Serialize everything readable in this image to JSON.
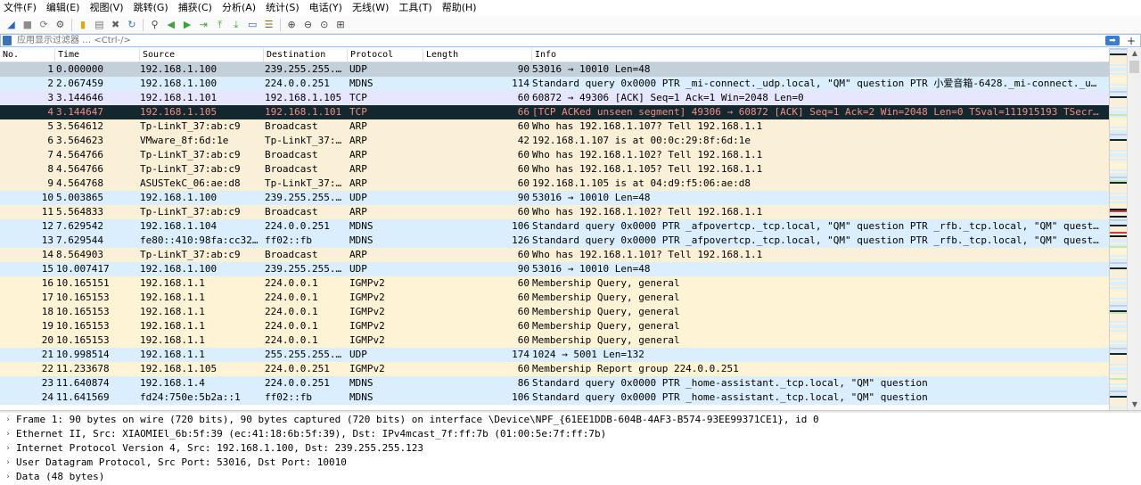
{
  "menu": [
    "文件(F)",
    "编辑(E)",
    "视图(V)",
    "跳转(G)",
    "捕获(C)",
    "分析(A)",
    "统计(S)",
    "电话(Y)",
    "无线(W)",
    "工具(T)",
    "帮助(H)"
  ],
  "toolbar_icons": [
    "shark-fin-start-icon",
    "stop-icon",
    "restart-icon",
    "capture-options-icon",
    "sep",
    "open-file-icon",
    "save-file-icon",
    "close-file-icon",
    "reload-icon",
    "sep",
    "find-icon",
    "go-back-icon",
    "go-forward-icon",
    "go-to-packet-icon",
    "first-packet-icon",
    "last-packet-icon",
    "auto-scroll-icon",
    "colorize-icon",
    "sep",
    "zoom-in-icon",
    "zoom-out-icon",
    "normal-size-icon",
    "resize-columns-icon"
  ],
  "filter": {
    "placeholder": "应用显示过滤器 … <Ctrl-/>",
    "plus": "+"
  },
  "columns": {
    "no": "No.",
    "time": "Time",
    "source": "Source",
    "destination": "Destination",
    "protocol": "Protocol",
    "length": "Length",
    "info": "Info"
  },
  "packets": [
    {
      "no": "1",
      "time": "0.000000",
      "src": "192.168.1.100",
      "dst": "239.255.255.…",
      "proto": "UDP",
      "len": "90",
      "info": "53016 → 10010 Len=48",
      "style": "first"
    },
    {
      "no": "2",
      "time": "2.067459",
      "src": "192.168.1.100",
      "dst": "224.0.0.251",
      "proto": "MDNS",
      "len": "114",
      "info": "Standard query 0x0000 PTR _mi-connect._udp.local, \"QM\" question PTR 小爱音箱-6428._mi-connect._u…",
      "style": "udp"
    },
    {
      "no": "3",
      "time": "3.144646",
      "src": "192.168.1.101",
      "dst": "192.168.1.105",
      "proto": "TCP",
      "len": "60",
      "info": "60872 → 49306 [ACK] Seq=1 Ack=1 Win=2048 Len=0",
      "style": "tcp"
    },
    {
      "no": "4",
      "time": "3.144647",
      "src": "192.168.1.105",
      "dst": "192.168.1.101",
      "proto": "TCP",
      "len": "66",
      "info": "[TCP ACKed unseen segment] 49306 → 60872 [ACK] Seq=1 Ack=2 Win=2048 Len=0 TSval=111915193 TSecr…",
      "style": "sel"
    },
    {
      "no": "5",
      "time": "3.564612",
      "src": "Tp-LinkT_37:ab:c9",
      "dst": "Broadcast",
      "proto": "ARP",
      "len": "60",
      "info": "Who has 192.168.1.107? Tell 192.168.1.1",
      "style": "arp"
    },
    {
      "no": "6",
      "time": "3.564623",
      "src": "VMware_8f:6d:1e",
      "dst": "Tp-LinkT_37:…",
      "proto": "ARP",
      "len": "42",
      "info": "192.168.1.107 is at 00:0c:29:8f:6d:1e",
      "style": "arp"
    },
    {
      "no": "7",
      "time": "4.564766",
      "src": "Tp-LinkT_37:ab:c9",
      "dst": "Broadcast",
      "proto": "ARP",
      "len": "60",
      "info": "Who has 192.168.1.102? Tell 192.168.1.1",
      "style": "arp"
    },
    {
      "no": "8",
      "time": "4.564766",
      "src": "Tp-LinkT_37:ab:c9",
      "dst": "Broadcast",
      "proto": "ARP",
      "len": "60",
      "info": "Who has 192.168.1.105? Tell 192.168.1.1",
      "style": "arp"
    },
    {
      "no": "9",
      "time": "4.564768",
      "src": "ASUSTekC_06:ae:d8",
      "dst": "Tp-LinkT_37:…",
      "proto": "ARP",
      "len": "60",
      "info": "192.168.1.105 is at 04:d9:f5:06:ae:d8",
      "style": "arp"
    },
    {
      "no": "10",
      "time": "5.003865",
      "src": "192.168.1.100",
      "dst": "239.255.255.…",
      "proto": "UDP",
      "len": "90",
      "info": "53016 → 10010 Len=48",
      "style": "udp"
    },
    {
      "no": "11",
      "time": "5.564833",
      "src": "Tp-LinkT_37:ab:c9",
      "dst": "Broadcast",
      "proto": "ARP",
      "len": "60",
      "info": "Who has 192.168.1.102? Tell 192.168.1.1",
      "style": "arp"
    },
    {
      "no": "12",
      "time": "7.629542",
      "src": "192.168.1.104",
      "dst": "224.0.0.251",
      "proto": "MDNS",
      "len": "106",
      "info": "Standard query 0x0000 PTR _afpovertcp._tcp.local, \"QM\" question PTR _rfb._tcp.local, \"QM\" quest…",
      "style": "udp"
    },
    {
      "no": "13",
      "time": "7.629544",
      "src": "fe80::410:98fa:cc32…",
      "dst": "ff02::fb",
      "proto": "MDNS",
      "len": "126",
      "info": "Standard query 0x0000 PTR _afpovertcp._tcp.local, \"QM\" question PTR _rfb._tcp.local, \"QM\" quest…",
      "style": "udp"
    },
    {
      "no": "14",
      "time": "8.564903",
      "src": "Tp-LinkT_37:ab:c9",
      "dst": "Broadcast",
      "proto": "ARP",
      "len": "60",
      "info": "Who has 192.168.1.101? Tell 192.168.1.1",
      "style": "arp"
    },
    {
      "no": "15",
      "time": "10.007417",
      "src": "192.168.1.100",
      "dst": "239.255.255.…",
      "proto": "UDP",
      "len": "90",
      "info": "53016 → 10010 Len=48",
      "style": "udp"
    },
    {
      "no": "16",
      "time": "10.165151",
      "src": "192.168.1.1",
      "dst": "224.0.0.1",
      "proto": "IGMPv2",
      "len": "60",
      "info": "Membership Query, general",
      "style": "igmp"
    },
    {
      "no": "17",
      "time": "10.165153",
      "src": "192.168.1.1",
      "dst": "224.0.0.1",
      "proto": "IGMPv2",
      "len": "60",
      "info": "Membership Query, general",
      "style": "igmp"
    },
    {
      "no": "18",
      "time": "10.165153",
      "src": "192.168.1.1",
      "dst": "224.0.0.1",
      "proto": "IGMPv2",
      "len": "60",
      "info": "Membership Query, general",
      "style": "igmp"
    },
    {
      "no": "19",
      "time": "10.165153",
      "src": "192.168.1.1",
      "dst": "224.0.0.1",
      "proto": "IGMPv2",
      "len": "60",
      "info": "Membership Query, general",
      "style": "igmp"
    },
    {
      "no": "20",
      "time": "10.165153",
      "src": "192.168.1.1",
      "dst": "224.0.0.1",
      "proto": "IGMPv2",
      "len": "60",
      "info": "Membership Query, general",
      "style": "igmp"
    },
    {
      "no": "21",
      "time": "10.998514",
      "src": "192.168.1.1",
      "dst": "255.255.255.…",
      "proto": "UDP",
      "len": "174",
      "info": "1024 → 5001 Len=132",
      "style": "udp"
    },
    {
      "no": "22",
      "time": "11.233678",
      "src": "192.168.1.105",
      "dst": "224.0.0.251",
      "proto": "IGMPv2",
      "len": "60",
      "info": "Membership Report group 224.0.0.251",
      "style": "igmp"
    },
    {
      "no": "23",
      "time": "11.640874",
      "src": "192.168.1.4",
      "dst": "224.0.0.251",
      "proto": "MDNS",
      "len": "86",
      "info": "Standard query 0x0000 PTR _home-assistant._tcp.local, \"QM\" question",
      "style": "udp"
    },
    {
      "no": "24",
      "time": "11.641569",
      "src": "fd24:750e:5b2a::1",
      "dst": "ff02::fb",
      "proto": "MDNS",
      "len": "106",
      "info": "Standard query 0x0000 PTR _home-assistant._tcp.local, \"QM\" question",
      "style": "udp"
    }
  ],
  "details": [
    "Frame 1: 90 bytes on wire (720 bits), 90 bytes captured (720 bits) on interface \\Device\\NPF_{61EE1DDB-604B-4AF3-B574-93EE99371CE1}, id 0",
    "Ethernet II, Src: XIAOMIEl_6b:5f:39 (ec:41:18:6b:5f:39), Dst: IPv4mcast_7f:ff:7b (01:00:5e:7f:ff:7b)",
    "Internet Protocol Version 4, Src: 192.168.1.100, Dst: 239.255.255.123",
    "User Datagram Protocol, Src Port: 53016, Dst Port: 10010",
    "Data (48 bytes)"
  ],
  "colors": {
    "udp": "#daeefe",
    "tcp": "#e7e6ff",
    "arp": "#faf0d7",
    "igmp": "#fff3d6",
    "selected_bg": "#12272e",
    "selected_fg": "#f78b83"
  }
}
